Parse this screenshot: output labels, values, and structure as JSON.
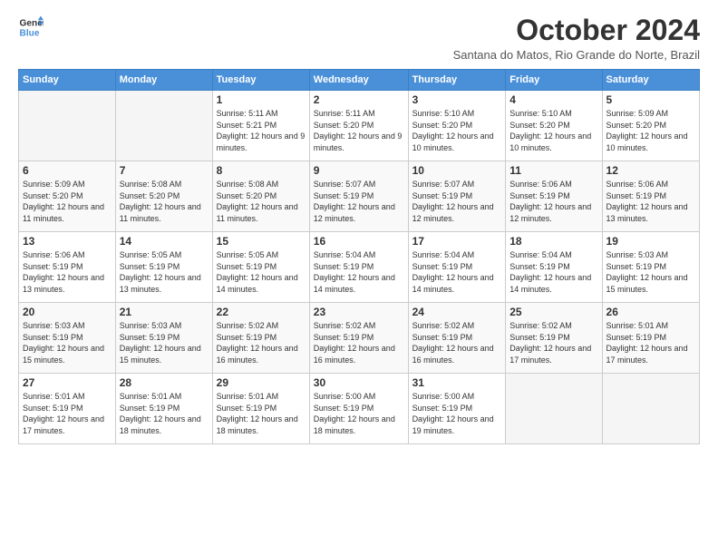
{
  "logo": {
    "line1": "General",
    "line2": "Blue"
  },
  "title": "October 2024",
  "subtitle": "Santana do Matos, Rio Grande do Norte, Brazil",
  "days_of_week": [
    "Sunday",
    "Monday",
    "Tuesday",
    "Wednesday",
    "Thursday",
    "Friday",
    "Saturday"
  ],
  "weeks": [
    [
      {
        "day": "",
        "info": ""
      },
      {
        "day": "",
        "info": ""
      },
      {
        "day": "1",
        "info": "Sunrise: 5:11 AM\nSunset: 5:21 PM\nDaylight: 12 hours and 9 minutes."
      },
      {
        "day": "2",
        "info": "Sunrise: 5:11 AM\nSunset: 5:20 PM\nDaylight: 12 hours and 9 minutes."
      },
      {
        "day": "3",
        "info": "Sunrise: 5:10 AM\nSunset: 5:20 PM\nDaylight: 12 hours and 10 minutes."
      },
      {
        "day": "4",
        "info": "Sunrise: 5:10 AM\nSunset: 5:20 PM\nDaylight: 12 hours and 10 minutes."
      },
      {
        "day": "5",
        "info": "Sunrise: 5:09 AM\nSunset: 5:20 PM\nDaylight: 12 hours and 10 minutes."
      }
    ],
    [
      {
        "day": "6",
        "info": "Sunrise: 5:09 AM\nSunset: 5:20 PM\nDaylight: 12 hours and 11 minutes."
      },
      {
        "day": "7",
        "info": "Sunrise: 5:08 AM\nSunset: 5:20 PM\nDaylight: 12 hours and 11 minutes."
      },
      {
        "day": "8",
        "info": "Sunrise: 5:08 AM\nSunset: 5:20 PM\nDaylight: 12 hours and 11 minutes."
      },
      {
        "day": "9",
        "info": "Sunrise: 5:07 AM\nSunset: 5:19 PM\nDaylight: 12 hours and 12 minutes."
      },
      {
        "day": "10",
        "info": "Sunrise: 5:07 AM\nSunset: 5:19 PM\nDaylight: 12 hours and 12 minutes."
      },
      {
        "day": "11",
        "info": "Sunrise: 5:06 AM\nSunset: 5:19 PM\nDaylight: 12 hours and 12 minutes."
      },
      {
        "day": "12",
        "info": "Sunrise: 5:06 AM\nSunset: 5:19 PM\nDaylight: 12 hours and 13 minutes."
      }
    ],
    [
      {
        "day": "13",
        "info": "Sunrise: 5:06 AM\nSunset: 5:19 PM\nDaylight: 12 hours and 13 minutes."
      },
      {
        "day": "14",
        "info": "Sunrise: 5:05 AM\nSunset: 5:19 PM\nDaylight: 12 hours and 13 minutes."
      },
      {
        "day": "15",
        "info": "Sunrise: 5:05 AM\nSunset: 5:19 PM\nDaylight: 12 hours and 14 minutes."
      },
      {
        "day": "16",
        "info": "Sunrise: 5:04 AM\nSunset: 5:19 PM\nDaylight: 12 hours and 14 minutes."
      },
      {
        "day": "17",
        "info": "Sunrise: 5:04 AM\nSunset: 5:19 PM\nDaylight: 12 hours and 14 minutes."
      },
      {
        "day": "18",
        "info": "Sunrise: 5:04 AM\nSunset: 5:19 PM\nDaylight: 12 hours and 14 minutes."
      },
      {
        "day": "19",
        "info": "Sunrise: 5:03 AM\nSunset: 5:19 PM\nDaylight: 12 hours and 15 minutes."
      }
    ],
    [
      {
        "day": "20",
        "info": "Sunrise: 5:03 AM\nSunset: 5:19 PM\nDaylight: 12 hours and 15 minutes."
      },
      {
        "day": "21",
        "info": "Sunrise: 5:03 AM\nSunset: 5:19 PM\nDaylight: 12 hours and 15 minutes."
      },
      {
        "day": "22",
        "info": "Sunrise: 5:02 AM\nSunset: 5:19 PM\nDaylight: 12 hours and 16 minutes."
      },
      {
        "day": "23",
        "info": "Sunrise: 5:02 AM\nSunset: 5:19 PM\nDaylight: 12 hours and 16 minutes."
      },
      {
        "day": "24",
        "info": "Sunrise: 5:02 AM\nSunset: 5:19 PM\nDaylight: 12 hours and 16 minutes."
      },
      {
        "day": "25",
        "info": "Sunrise: 5:02 AM\nSunset: 5:19 PM\nDaylight: 12 hours and 17 minutes."
      },
      {
        "day": "26",
        "info": "Sunrise: 5:01 AM\nSunset: 5:19 PM\nDaylight: 12 hours and 17 minutes."
      }
    ],
    [
      {
        "day": "27",
        "info": "Sunrise: 5:01 AM\nSunset: 5:19 PM\nDaylight: 12 hours and 17 minutes."
      },
      {
        "day": "28",
        "info": "Sunrise: 5:01 AM\nSunset: 5:19 PM\nDaylight: 12 hours and 18 minutes."
      },
      {
        "day": "29",
        "info": "Sunrise: 5:01 AM\nSunset: 5:19 PM\nDaylight: 12 hours and 18 minutes."
      },
      {
        "day": "30",
        "info": "Sunrise: 5:00 AM\nSunset: 5:19 PM\nDaylight: 12 hours and 18 minutes."
      },
      {
        "day": "31",
        "info": "Sunrise: 5:00 AM\nSunset: 5:19 PM\nDaylight: 12 hours and 19 minutes."
      },
      {
        "day": "",
        "info": ""
      },
      {
        "day": "",
        "info": ""
      }
    ]
  ]
}
